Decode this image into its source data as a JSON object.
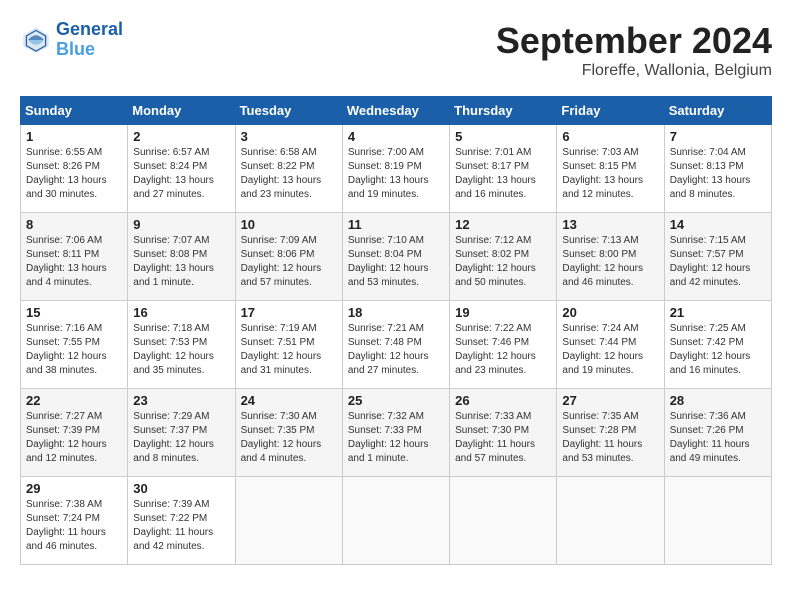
{
  "header": {
    "logo_line1": "General",
    "logo_line2": "Blue",
    "month": "September 2024",
    "location": "Floreffe, Wallonia, Belgium"
  },
  "weekdays": [
    "Sunday",
    "Monday",
    "Tuesday",
    "Wednesday",
    "Thursday",
    "Friday",
    "Saturday"
  ],
  "weeks": [
    [
      {
        "day": "1",
        "info": "Sunrise: 6:55 AM\nSunset: 8:26 PM\nDaylight: 13 hours\nand 30 minutes."
      },
      {
        "day": "2",
        "info": "Sunrise: 6:57 AM\nSunset: 8:24 PM\nDaylight: 13 hours\nand 27 minutes."
      },
      {
        "day": "3",
        "info": "Sunrise: 6:58 AM\nSunset: 8:22 PM\nDaylight: 13 hours\nand 23 minutes."
      },
      {
        "day": "4",
        "info": "Sunrise: 7:00 AM\nSunset: 8:19 PM\nDaylight: 13 hours\nand 19 minutes."
      },
      {
        "day": "5",
        "info": "Sunrise: 7:01 AM\nSunset: 8:17 PM\nDaylight: 13 hours\nand 16 minutes."
      },
      {
        "day": "6",
        "info": "Sunrise: 7:03 AM\nSunset: 8:15 PM\nDaylight: 13 hours\nand 12 minutes."
      },
      {
        "day": "7",
        "info": "Sunrise: 7:04 AM\nSunset: 8:13 PM\nDaylight: 13 hours\nand 8 minutes."
      }
    ],
    [
      {
        "day": "8",
        "info": "Sunrise: 7:06 AM\nSunset: 8:11 PM\nDaylight: 13 hours\nand 4 minutes."
      },
      {
        "day": "9",
        "info": "Sunrise: 7:07 AM\nSunset: 8:08 PM\nDaylight: 13 hours\nand 1 minute."
      },
      {
        "day": "10",
        "info": "Sunrise: 7:09 AM\nSunset: 8:06 PM\nDaylight: 12 hours\nand 57 minutes."
      },
      {
        "day": "11",
        "info": "Sunrise: 7:10 AM\nSunset: 8:04 PM\nDaylight: 12 hours\nand 53 minutes."
      },
      {
        "day": "12",
        "info": "Sunrise: 7:12 AM\nSunset: 8:02 PM\nDaylight: 12 hours\nand 50 minutes."
      },
      {
        "day": "13",
        "info": "Sunrise: 7:13 AM\nSunset: 8:00 PM\nDaylight: 12 hours\nand 46 minutes."
      },
      {
        "day": "14",
        "info": "Sunrise: 7:15 AM\nSunset: 7:57 PM\nDaylight: 12 hours\nand 42 minutes."
      }
    ],
    [
      {
        "day": "15",
        "info": "Sunrise: 7:16 AM\nSunset: 7:55 PM\nDaylight: 12 hours\nand 38 minutes."
      },
      {
        "day": "16",
        "info": "Sunrise: 7:18 AM\nSunset: 7:53 PM\nDaylight: 12 hours\nand 35 minutes."
      },
      {
        "day": "17",
        "info": "Sunrise: 7:19 AM\nSunset: 7:51 PM\nDaylight: 12 hours\nand 31 minutes."
      },
      {
        "day": "18",
        "info": "Sunrise: 7:21 AM\nSunset: 7:48 PM\nDaylight: 12 hours\nand 27 minutes."
      },
      {
        "day": "19",
        "info": "Sunrise: 7:22 AM\nSunset: 7:46 PM\nDaylight: 12 hours\nand 23 minutes."
      },
      {
        "day": "20",
        "info": "Sunrise: 7:24 AM\nSunset: 7:44 PM\nDaylight: 12 hours\nand 19 minutes."
      },
      {
        "day": "21",
        "info": "Sunrise: 7:25 AM\nSunset: 7:42 PM\nDaylight: 12 hours\nand 16 minutes."
      }
    ],
    [
      {
        "day": "22",
        "info": "Sunrise: 7:27 AM\nSunset: 7:39 PM\nDaylight: 12 hours\nand 12 minutes."
      },
      {
        "day": "23",
        "info": "Sunrise: 7:29 AM\nSunset: 7:37 PM\nDaylight: 12 hours\nand 8 minutes."
      },
      {
        "day": "24",
        "info": "Sunrise: 7:30 AM\nSunset: 7:35 PM\nDaylight: 12 hours\nand 4 minutes."
      },
      {
        "day": "25",
        "info": "Sunrise: 7:32 AM\nSunset: 7:33 PM\nDaylight: 12 hours\nand 1 minute."
      },
      {
        "day": "26",
        "info": "Sunrise: 7:33 AM\nSunset: 7:30 PM\nDaylight: 11 hours\nand 57 minutes."
      },
      {
        "day": "27",
        "info": "Sunrise: 7:35 AM\nSunset: 7:28 PM\nDaylight: 11 hours\nand 53 minutes."
      },
      {
        "day": "28",
        "info": "Sunrise: 7:36 AM\nSunset: 7:26 PM\nDaylight: 11 hours\nand 49 minutes."
      }
    ],
    [
      {
        "day": "29",
        "info": "Sunrise: 7:38 AM\nSunset: 7:24 PM\nDaylight: 11 hours\nand 46 minutes."
      },
      {
        "day": "30",
        "info": "Sunrise: 7:39 AM\nSunset: 7:22 PM\nDaylight: 11 hours\nand 42 minutes."
      },
      null,
      null,
      null,
      null,
      null
    ]
  ]
}
